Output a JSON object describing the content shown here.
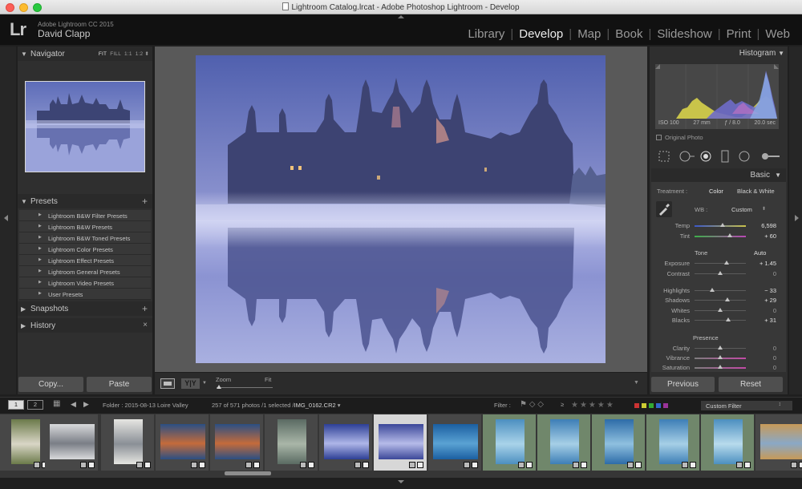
{
  "window": {
    "title": "Lightroom Catalog.lrcat - Adobe Photoshop Lightroom - Develop"
  },
  "identity": {
    "logo": "Lr",
    "app_name": "Adobe Lightroom CC 2015",
    "user": "David Clapp"
  },
  "modules": [
    "Library",
    "Develop",
    "Map",
    "Book",
    "Slideshow",
    "Print",
    "Web"
  ],
  "active_module": "Develop",
  "left_panel": {
    "navigator": {
      "title": "Navigator",
      "zoom_options": [
        "FIT",
        "FILL",
        "1:1",
        "1:2"
      ],
      "zoom_active": "FIT"
    },
    "presets": {
      "title": "Presets",
      "items": [
        "Lightroom B&W Filter Presets",
        "Lightroom B&W Presets",
        "Lightroom B&W Toned Presets",
        "Lightroom Color Presets",
        "Lightroom Effect Presets",
        "Lightroom General Presets",
        "Lightroom Video Presets",
        "User Presets"
      ]
    },
    "snapshots": {
      "title": "Snapshots"
    },
    "history": {
      "title": "History"
    },
    "copy_label": "Copy...",
    "paste_label": "Paste"
  },
  "toolbar": {
    "yy_label": "Y|Y",
    "zoom_label": "Zoom",
    "fit_label": "Fit",
    "zoom_level": 0
  },
  "right_panel": {
    "histogram": {
      "title": "Histogram",
      "iso": "ISO 100",
      "focal": "27 mm",
      "aperture": "ƒ / 8.0",
      "shutter": "20.0 sec",
      "original_photo_label": "Original Photo"
    },
    "basic": {
      "title": "Basic",
      "treatment_label": "Treatment :",
      "color_label": "Color",
      "bw_label": "Black & White",
      "wb_label": "WB :",
      "wb_value": "Custom",
      "tone_label": "Tone",
      "auto_label": "Auto",
      "presence_label": "Presence",
      "sliders": {
        "temp": {
          "label": "Temp",
          "value": "6,598",
          "position": 0.54
        },
        "tint": {
          "label": "Tint",
          "value": "+ 60",
          "position": 0.68
        },
        "exposure": {
          "label": "Exposure",
          "value": "+ 1.45",
          "position": 0.62
        },
        "contrast": {
          "label": "Contrast",
          "value": "0",
          "position": 0.5
        },
        "highlights": {
          "label": "Highlights",
          "value": "− 33",
          "position": 0.34
        },
        "shadows": {
          "label": "Shadows",
          "value": "+ 29",
          "position": 0.64
        },
        "whites": {
          "label": "Whites",
          "value": "0",
          "position": 0.5
        },
        "blacks": {
          "label": "Blacks",
          "value": "+ 31",
          "position": 0.66
        },
        "clarity": {
          "label": "Clarity",
          "value": "0",
          "position": 0.5
        },
        "vibrance": {
          "label": "Vibrance",
          "value": "0",
          "position": 0.5
        },
        "saturation": {
          "label": "Saturation",
          "value": "0",
          "position": 0.5
        }
      }
    },
    "previous_label": "Previous",
    "reset_label": "Reset"
  },
  "filmstrip_bar": {
    "monitor1": "1",
    "monitor2": "2",
    "folder_text": "Folder : 2015-08-13 Loire Valley",
    "count_text": "257 of 571 photos /1 selected /",
    "filename": "IMG_0162.CR2",
    "filter_label": "Filter :",
    "stars": "★★★★★",
    "rating_op": "≥",
    "custom_filter": "Custom Filter",
    "label_colors": [
      "#c33",
      "#cc3",
      "#3a3",
      "#36c",
      "#939"
    ]
  },
  "colors": {
    "accent_active": "#ececec",
    "panel_bg": "#2f2f2f",
    "filmstrip_green": "#70876b",
    "selected_cell": "#d7d7d7"
  }
}
